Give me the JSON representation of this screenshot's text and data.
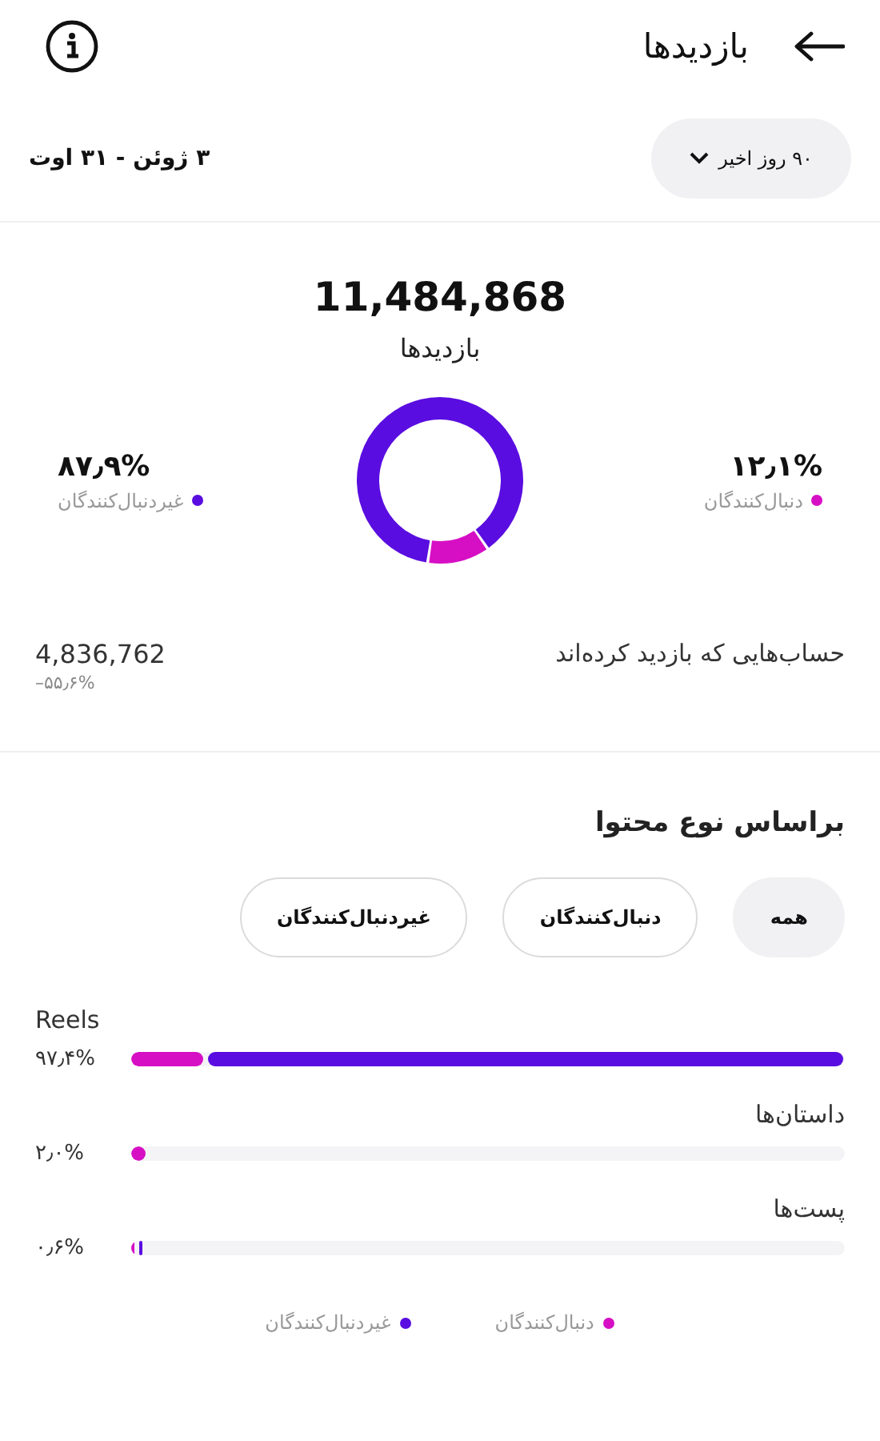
{
  "header": {
    "title": "بازدیدها"
  },
  "period": {
    "dropdown": "۹۰ روز اخیر",
    "date_range": "۳ ژوئن - ۳۱ اوت"
  },
  "summary": {
    "total": "11,484,868",
    "label": "بازدیدها"
  },
  "split": {
    "chart_data": {
      "type": "donut",
      "categories": [
        "دنبال‌کنندگان",
        "غیردنبال‌کنندگان"
      ],
      "values": [
        12.1,
        87.9
      ]
    },
    "slices": [
      {
        "color": "#d60fc4",
        "percent": "۱۲٫۱%"
      },
      {
        "color": "#5a0de0",
        "percent": "۸۷٫۹%"
      }
    ]
  },
  "accounts": {
    "label": "حساب‌هایی که بازدید کرده‌اند",
    "value": "4,836,762",
    "change": "–۵۵٫۶%"
  },
  "content_section": {
    "title": "براساس نوع محتوا"
  },
  "filters": [
    {
      "label": "همه",
      "selected": true
    },
    {
      "label": "دنبال‌کنندگان",
      "selected": false
    },
    {
      "label": "غیردنبال‌کنندگان",
      "selected": false
    }
  ],
  "content_types": [
    {
      "label": "Reels",
      "percent": "۹۷٫۴%",
      "segments": [
        {
          "kind": "followers",
          "level": 0.1
        },
        {
          "kind": "non_followers",
          "level": 0.89
        }
      ]
    },
    {
      "label": "داستان‌ها",
      "percent": "۲٫۰%",
      "segments": [
        {
          "kind": "followers",
          "level": 0.02
        }
      ]
    },
    {
      "label": "پست‌ها",
      "percent": "۰٫۶%",
      "segments": [
        {
          "kind": "followers",
          "level": 0.004
        },
        {
          "kind": "non_followers",
          "level": 0.004
        }
      ]
    }
  ],
  "legend": [
    {
      "kind": "followers",
      "label": "دنبال‌کنندگان"
    },
    {
      "kind": "non_followers",
      "label": "غیردنبال‌کنندگان"
    }
  ]
}
